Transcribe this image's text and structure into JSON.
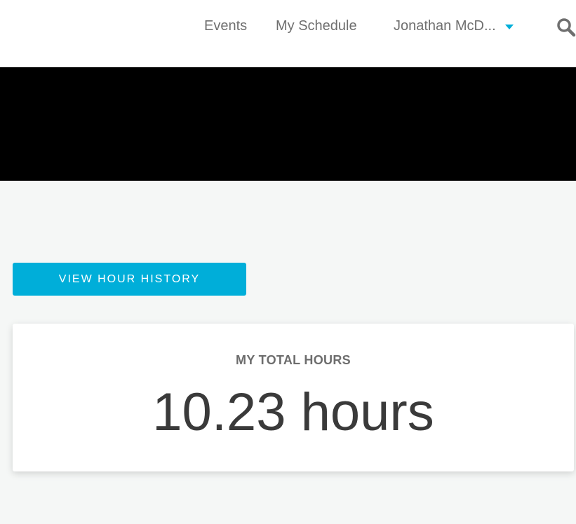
{
  "nav": {
    "events_label": "Events",
    "schedule_label": "My Schedule",
    "user_label": "Jonathan McD...",
    "caret_icon": "chevron-down-icon",
    "search_icon": "search-icon",
    "accent_color": "#00aed9"
  },
  "actions": {
    "view_history_label": "VIEW HOUR HISTORY"
  },
  "summary": {
    "title": "MY TOTAL HOURS",
    "value": "10.23 hours"
  }
}
